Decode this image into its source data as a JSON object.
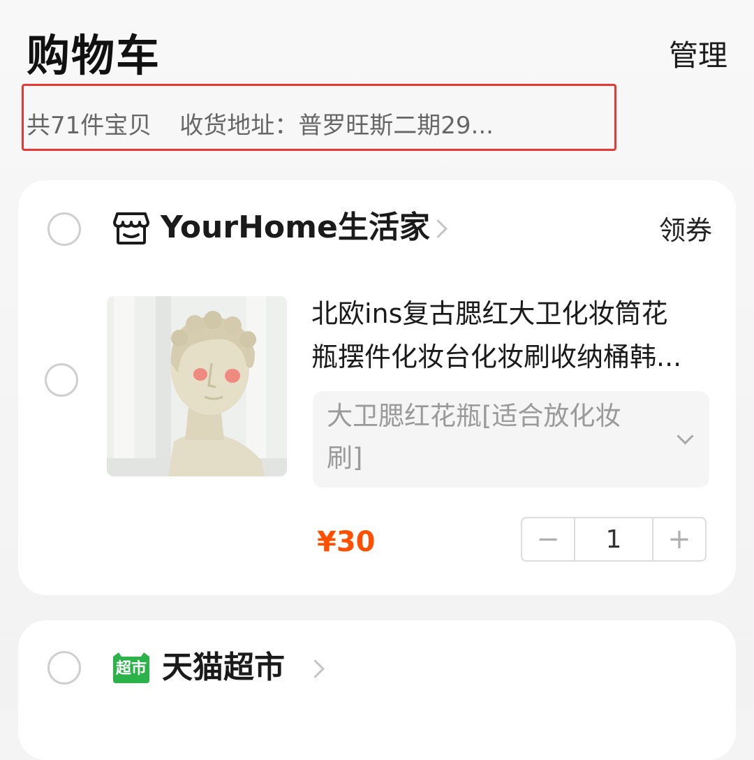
{
  "header": {
    "title": "购物车",
    "manage_label": "管理"
  },
  "summary": {
    "count_text": "共71件宝贝",
    "address_text": "收货地址：普罗旺斯二期29..."
  },
  "stores": [
    {
      "name": "YourHome生活家",
      "coupon_label": "领券",
      "items": [
        {
          "title_line1": "北欧ins复古腮红大卫化妆筒花",
          "title_line2": "瓶摆件化妆台化妆刷收纳桶韩...",
          "sku": "大卫腮红花瓶[适合放化妆刷]",
          "price": "¥30",
          "quantity": "1",
          "minus_label": "−",
          "plus_label": "+"
        }
      ]
    },
    {
      "name": "天猫超市",
      "badge_label": "超市"
    }
  ],
  "colors": {
    "price": "#ff5000",
    "highlight_border": "#e53935",
    "tmall_green": "#2bb34a"
  }
}
